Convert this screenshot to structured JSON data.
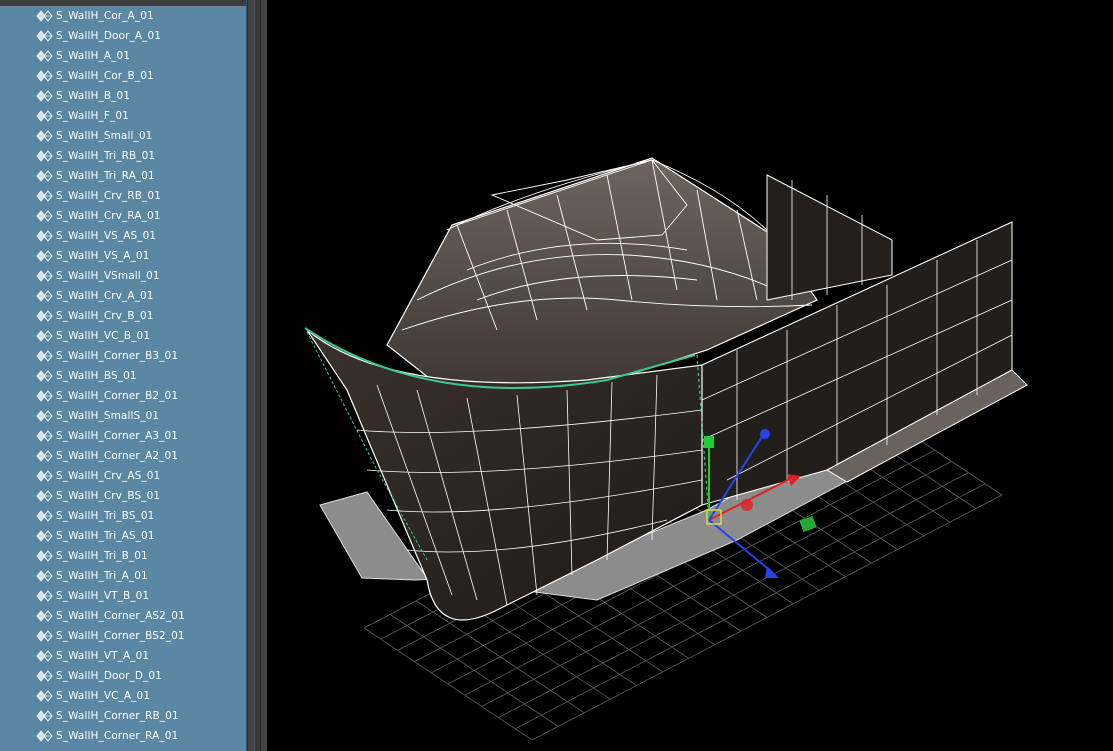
{
  "outliner": {
    "items": [
      {
        "label": "S_WallH_Cor_A_01"
      },
      {
        "label": "S_WallH_Door_A_01"
      },
      {
        "label": "S_WallH_A_01"
      },
      {
        "label": "S_WallH_Cor_B_01"
      },
      {
        "label": "S_WallH_B_01"
      },
      {
        "label": "S_WallH_F_01"
      },
      {
        "label": "S_WallH_Small_01"
      },
      {
        "label": "S_WallH_Tri_RB_01"
      },
      {
        "label": "S_WallH_Tri_RA_01"
      },
      {
        "label": "S_WallH_Crv_RB_01"
      },
      {
        "label": "S_WallH_Crv_RA_01"
      },
      {
        "label": "S_WallH_VS_AS_01"
      },
      {
        "label": "S_WallH_VS_A_01"
      },
      {
        "label": "S_WallH_VSmall_01"
      },
      {
        "label": "S_WallH_Crv_A_01"
      },
      {
        "label": "S_WallH_Crv_B_01"
      },
      {
        "label": "S_WallH_VC_B_01"
      },
      {
        "label": "S_WallH_Corner_B3_01"
      },
      {
        "label": "S_WallH_BS_01"
      },
      {
        "label": "S_WallH_Corner_B2_01"
      },
      {
        "label": "S_WallH_SmallS_01"
      },
      {
        "label": "S_WallH_Corner_A3_01"
      },
      {
        "label": "S_WallH_Corner_A2_01"
      },
      {
        "label": "S_WallH_Crv_AS_01"
      },
      {
        "label": "S_WallH_Crv_BS_01"
      },
      {
        "label": "S_WallH_Tri_BS_01"
      },
      {
        "label": "S_WallH_Tri_AS_01"
      },
      {
        "label": "S_WallH_Tri_B_01"
      },
      {
        "label": "S_WallH_Tri_A_01"
      },
      {
        "label": "S_WallH_VT_B_01"
      },
      {
        "label": "S_WallH_Corner_AS2_01"
      },
      {
        "label": "S_WallH_Corner_BS2_01"
      },
      {
        "label": "S_WallH_VT_A_01"
      },
      {
        "label": "S_WallH_Door_D_01"
      },
      {
        "label": "S_WallH_VC_A_01"
      },
      {
        "label": "S_WallH_Corner_RB_01"
      },
      {
        "label": "S_WallH_Corner_RA_01"
      }
    ],
    "item_icon": "mesh-transform-node-icon",
    "background_color": "#5a87a3"
  },
  "viewport": {
    "background_color": "#000000",
    "wireframe_color": "#ffffff",
    "selection_color": "#3cc88c",
    "gizmo": {
      "x_axis_color": "#dd2222",
      "y_axis_color": "#22cc33",
      "z_axis_color": "#2244ee"
    },
    "grid_icon": "ground-grid",
    "model_icon": "building-wireframe-model"
  }
}
